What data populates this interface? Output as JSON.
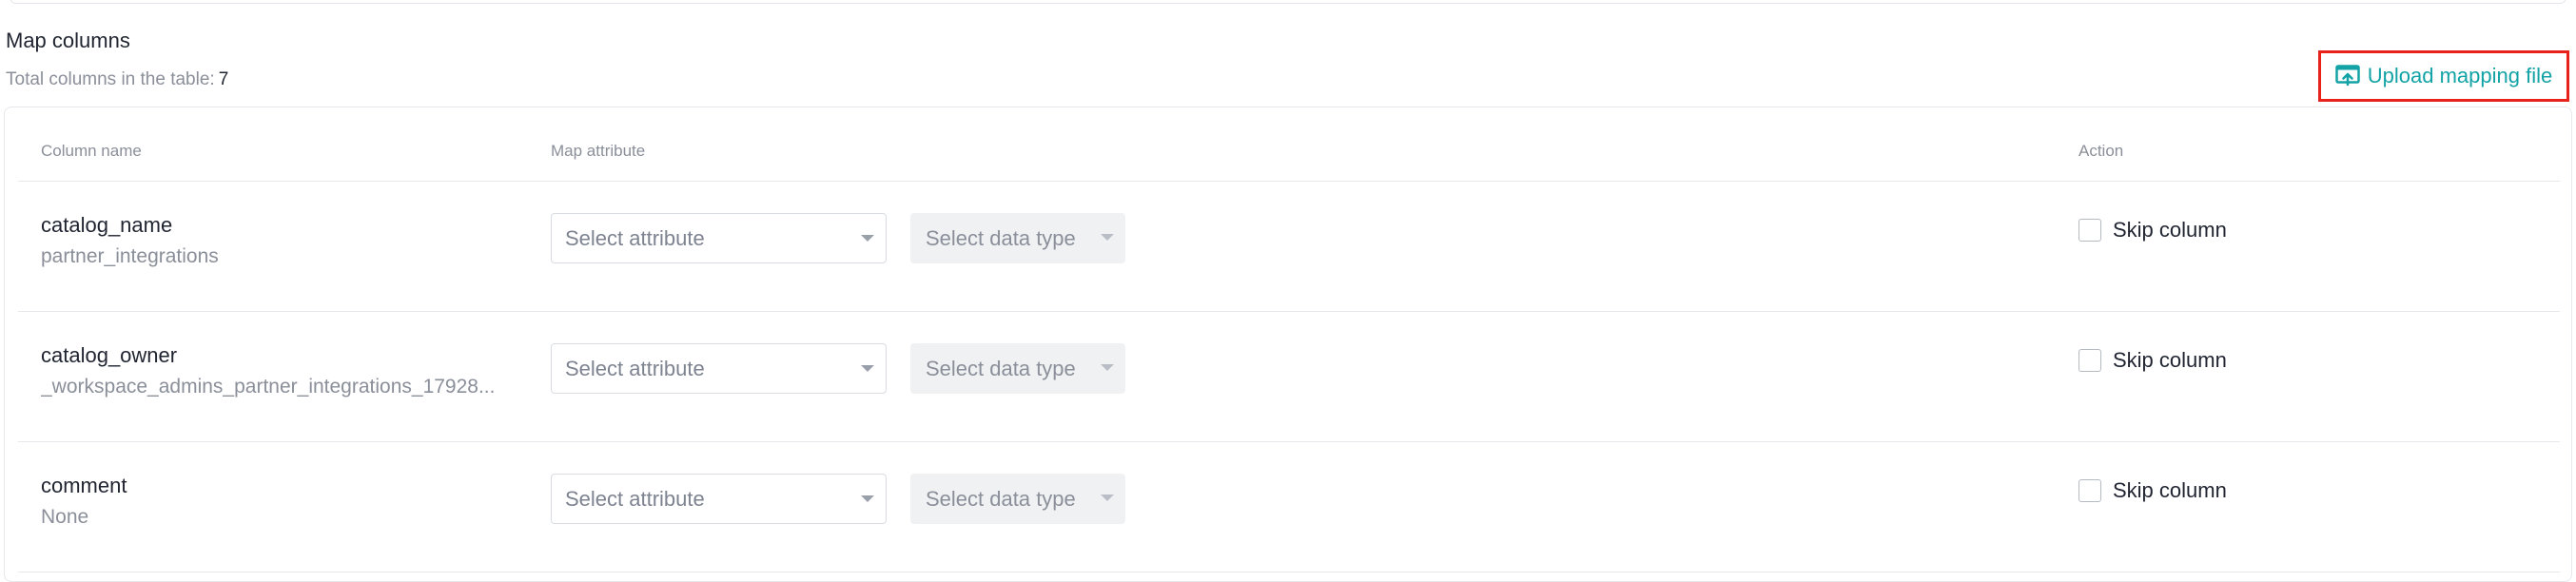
{
  "section": {
    "title": "Map columns",
    "total_label": "Total columns in the table:",
    "total_count": "7"
  },
  "upload": {
    "label": "Upload mapping file",
    "icon": "upload-file-icon",
    "accent_color": "#13a3a6",
    "highlight_color": "#e8221b"
  },
  "table": {
    "headers": {
      "column_name": "Column name",
      "map_attribute": "Map attribute",
      "action": "Action"
    },
    "rows": [
      {
        "name": "catalog_name",
        "value": "partner_integrations",
        "attribute_placeholder": "Select attribute",
        "type_placeholder": "Select data type",
        "skip_label": "Skip column"
      },
      {
        "name": "catalog_owner",
        "value": "_workspace_admins_partner_integrations_17928...",
        "attribute_placeholder": "Select attribute",
        "type_placeholder": "Select data type",
        "skip_label": "Skip column"
      },
      {
        "name": "comment",
        "value": "None",
        "attribute_placeholder": "Select attribute",
        "type_placeholder": "Select data type",
        "skip_label": "Skip column"
      }
    ]
  }
}
